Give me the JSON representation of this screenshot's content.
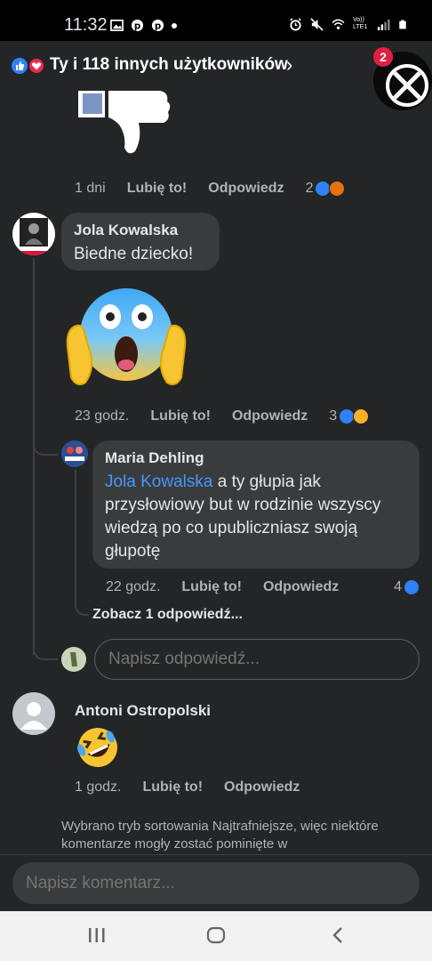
{
  "status_bar": {
    "time": "11:32",
    "network_label": "Vo)) LTE1"
  },
  "reactions_header": {
    "text": "Ty i 118 innych użytkowników",
    "chevron": "›",
    "icons": [
      "like-icon",
      "love-icon"
    ]
  },
  "chathead": {
    "badge": "2"
  },
  "comments": [
    {
      "id": "c0",
      "sticker": "thumbs-down-sticker",
      "time": "1 dni",
      "like_label": "Lubię to!",
      "reply_label": "Odpowiedz",
      "reaction_count": "2",
      "reactions": [
        "like-icon",
        "angry-icon"
      ]
    },
    {
      "id": "c1",
      "author": "Jola Kowalska",
      "text": "Biedne dziecko!",
      "sticker": "screaming-face-emoji",
      "time": "23 godz.",
      "like_label": "Lubię to!",
      "reply_label": "Odpowiedz",
      "reaction_count": "3",
      "reactions": [
        "like-icon",
        "sad-icon"
      ]
    },
    {
      "id": "c1r1",
      "author": "Maria Dehling",
      "mention": "Jola Kowalska",
      "text": " a ty głupia jak przysłowiowy but w rodzinie wszyscy wiedzą po co upubliczniasz swoją głupotę",
      "time": "22 godz.",
      "like_label": "Lubię to!",
      "reply_label": "Odpowiedz",
      "reaction_count": "4",
      "reactions": [
        "like-icon"
      ]
    },
    {
      "id": "c2",
      "author": "Antoni Ostropolski",
      "sticker": "rolling-laughing-emoji",
      "time": "1 godz.",
      "like_label": "Lubię to!",
      "reply_label": "Odpowiedz"
    }
  ],
  "see_replies": "Zobacz 1 odpowiedź...",
  "reply_input_placeholder": "Napisz odpowiedź...",
  "sort_note": "Wybrano tryb sortowania Najtrafniejsze, więc niektóre komentarze mogły zostać pominięte w",
  "composer_placeholder": "Napisz komentarz...",
  "colors": {
    "background": "#242526",
    "bubble": "#3a3b3c",
    "mention": "#4599ff",
    "like": "#2e81f7",
    "love": "#f0284a",
    "badge": "#e41e3f"
  }
}
